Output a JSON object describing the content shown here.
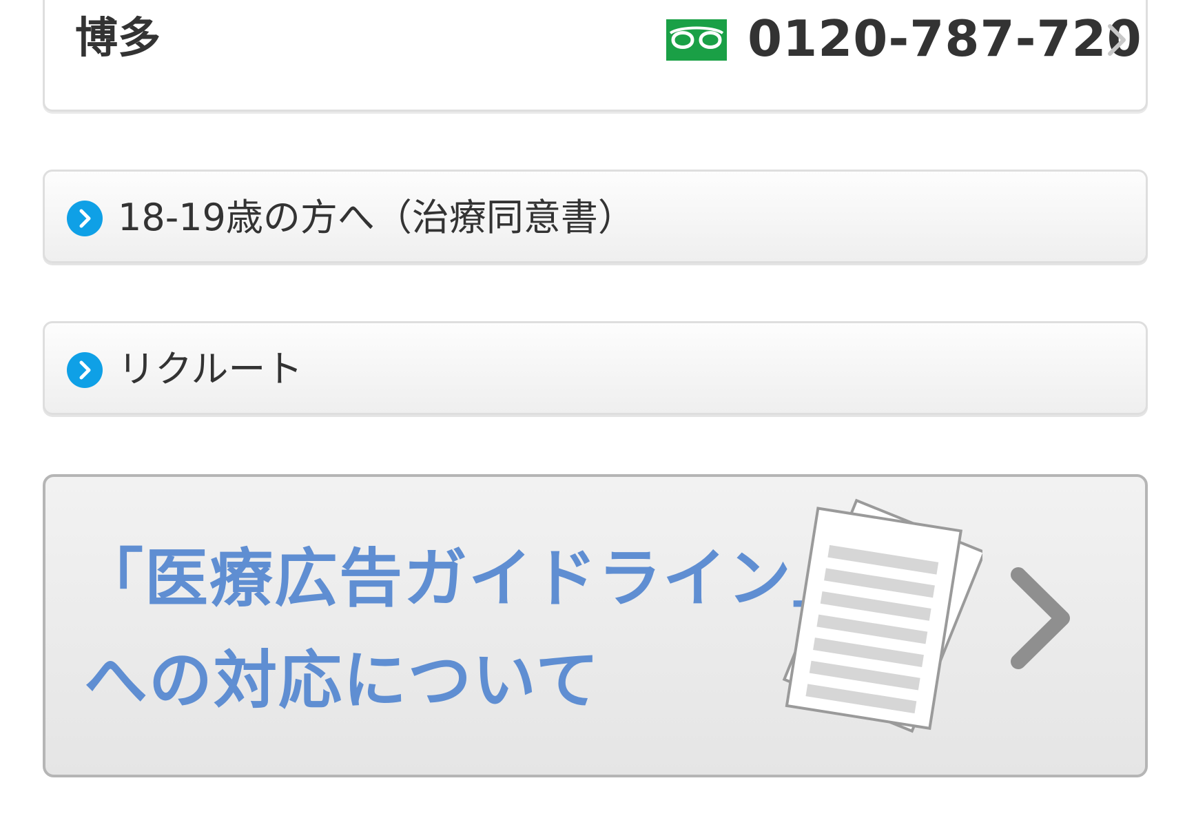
{
  "contact": {
    "branch": "博多",
    "phone": "0120-787-720",
    "icon": "freedial-icon",
    "icon_color": "#1aa046"
  },
  "links": [
    {
      "label": "18-19歳の方へ（治療同意書）",
      "icon": "chevron-circle-icon",
      "icon_color": "#0fa0e6"
    },
    {
      "label": "リクルート",
      "icon": "chevron-circle-icon",
      "icon_color": "#0fa0e6"
    }
  ],
  "banner": {
    "line1": "「医療広告ガイドライン」",
    "line2": "への対応について",
    "text_color": "#5f8ed2",
    "icon": "document-icon",
    "arrow_icon": "chevron-right-icon"
  }
}
